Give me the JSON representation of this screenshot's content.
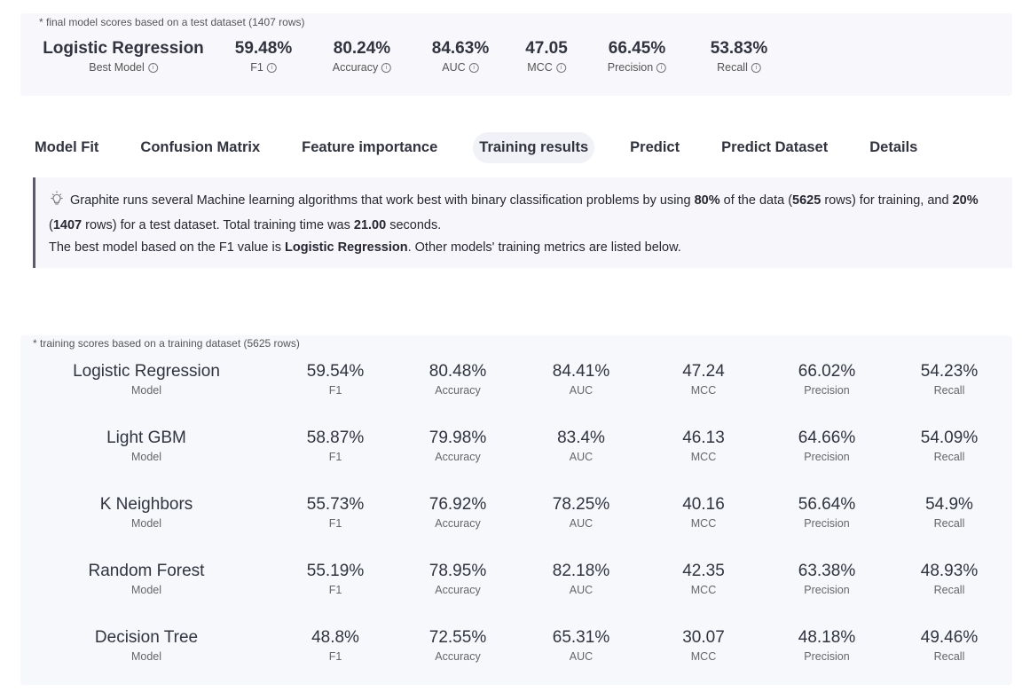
{
  "final": {
    "note": "* final model scores based on a test dataset (1407 rows)",
    "metrics": [
      {
        "value": "Logistic Regression",
        "label": "Best Model"
      },
      {
        "value": "59.48%",
        "label": "F1"
      },
      {
        "value": "80.24%",
        "label": "Accuracy"
      },
      {
        "value": "84.63%",
        "label": "AUC"
      },
      {
        "value": "47.05",
        "label": "MCC"
      },
      {
        "value": "66.45%",
        "label": "Precision"
      },
      {
        "value": "53.83%",
        "label": "Recall"
      }
    ]
  },
  "tabs": [
    {
      "label": "Model Fit",
      "active": false
    },
    {
      "label": "Confusion Matrix",
      "active": false
    },
    {
      "label": "Feature importance",
      "active": false
    },
    {
      "label": "Training results",
      "active": true
    },
    {
      "label": "Predict",
      "active": false
    },
    {
      "label": "Predict Dataset",
      "active": false
    },
    {
      "label": "Details",
      "active": false
    }
  ],
  "info": {
    "t1": "Graphite runs several Machine learning algorithms that work best with binary classification problems by using ",
    "b1": "80%",
    "t2": " of the data (",
    "b2": "5625",
    "t3": " rows) for training, and ",
    "b3": "20%",
    "t4": " (",
    "b4": "1407",
    "t5": " rows) for a test dataset. Total training time was ",
    "b5": "21.00",
    "t6": " seconds.",
    "t7": "The best model based on the F1 value is ",
    "b6": "Logistic Regression",
    "t8": ". Other models' training metrics are listed below."
  },
  "training": {
    "note": "* training scores based on a training dataset (5625 rows)",
    "labels": {
      "model": "Model",
      "f1": "F1",
      "accuracy": "Accuracy",
      "auc": "AUC",
      "mcc": "MCC",
      "precision": "Precision",
      "recall": "Recall"
    },
    "rows": [
      {
        "model": "Logistic Regression",
        "f1": "59.54%",
        "accuracy": "80.48%",
        "auc": "84.41%",
        "mcc": "47.24",
        "precision": "66.02%",
        "recall": "54.23%"
      },
      {
        "model": "Light GBM",
        "f1": "58.87%",
        "accuracy": "79.98%",
        "auc": "83.4%",
        "mcc": "46.13",
        "precision": "64.66%",
        "recall": "54.09%"
      },
      {
        "model": "K Neighbors",
        "f1": "55.73%",
        "accuracy": "76.92%",
        "auc": "78.25%",
        "mcc": "40.16",
        "precision": "56.64%",
        "recall": "54.9%"
      },
      {
        "model": "Random Forest",
        "f1": "55.19%",
        "accuracy": "78.95%",
        "auc": "82.18%",
        "mcc": "42.35",
        "precision": "63.38%",
        "recall": "48.93%"
      },
      {
        "model": "Decision Tree",
        "f1": "48.8%",
        "accuracy": "72.55%",
        "auc": "65.31%",
        "mcc": "30.07",
        "precision": "48.18%",
        "recall": "49.46%"
      }
    ]
  }
}
